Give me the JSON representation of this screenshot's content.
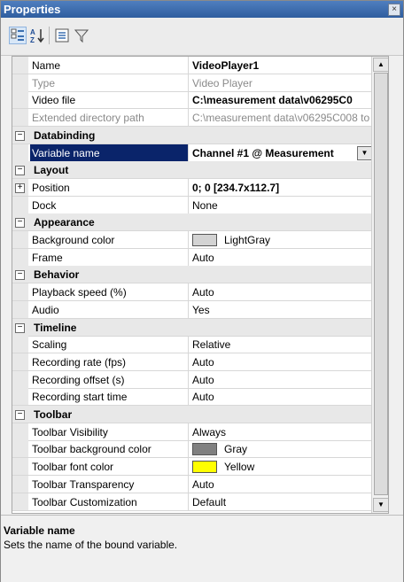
{
  "window": {
    "title": "Properties",
    "close_label": "×"
  },
  "toolbar": {
    "buttons": [
      {
        "name": "categorized-button",
        "icon": "categorized-icon"
      },
      {
        "name": "alphabetical-button",
        "icon": "sort-alphabetical-icon"
      },
      {
        "name": "property-pages-button",
        "icon": "property-pages-icon"
      },
      {
        "name": "filter-button",
        "icon": "filter-icon"
      }
    ]
  },
  "grid": {
    "rows": [
      {
        "kind": "prop",
        "label": "Name",
        "value": "VideoPlayer1",
        "bold": true
      },
      {
        "kind": "prop",
        "label": "Type",
        "value": "Video Player",
        "dim": true
      },
      {
        "kind": "prop",
        "label": "Video file",
        "value": "C:\\measurement data\\v06295C0",
        "bold": true
      },
      {
        "kind": "prop",
        "label": "Extended directory path",
        "value": "C:\\measurement data\\v06295C008 to",
        "dim": true
      },
      {
        "kind": "cat",
        "label": "Databinding",
        "expander": "−"
      },
      {
        "kind": "prop",
        "label": "Variable name",
        "value": "Channel #1 @ Measurement",
        "bold": true,
        "selected": true,
        "dropdown": true
      },
      {
        "kind": "cat",
        "label": "Layout",
        "expander": "−"
      },
      {
        "kind": "prop",
        "label": "Position",
        "value": "0; 0 [234.7x112.7]",
        "bold": true,
        "expander": "+"
      },
      {
        "kind": "prop",
        "label": "Dock",
        "value": "None"
      },
      {
        "kind": "cat",
        "label": "Appearance",
        "expander": "−"
      },
      {
        "kind": "prop",
        "label": "Background color",
        "value": "LightGray",
        "swatch": "#d3d3d3"
      },
      {
        "kind": "prop",
        "label": "Frame",
        "value": "Auto"
      },
      {
        "kind": "cat",
        "label": "Behavior",
        "expander": "−"
      },
      {
        "kind": "prop",
        "label": "Playback speed (%)",
        "value": "Auto"
      },
      {
        "kind": "prop",
        "label": "Audio",
        "value": "Yes"
      },
      {
        "kind": "cat",
        "label": "Timeline",
        "expander": "−"
      },
      {
        "kind": "prop",
        "label": "Scaling",
        "value": "Relative"
      },
      {
        "kind": "prop",
        "label": "Recording rate (fps)",
        "value": "Auto"
      },
      {
        "kind": "prop",
        "label": "Recording offset (s)",
        "value": "Auto"
      },
      {
        "kind": "prop",
        "label": "Recording start time",
        "value": "Auto"
      },
      {
        "kind": "cat",
        "label": "Toolbar",
        "expander": "−"
      },
      {
        "kind": "prop",
        "label": "Toolbar Visibility",
        "value": "Always"
      },
      {
        "kind": "prop",
        "label": "Toolbar background color",
        "value": "Gray",
        "swatch": "#808080"
      },
      {
        "kind": "prop",
        "label": "Toolbar font color",
        "value": "Yellow",
        "swatch": "#ffff00"
      },
      {
        "kind": "prop",
        "label": "Toolbar Transparency",
        "value": "Auto"
      },
      {
        "kind": "prop",
        "label": "Toolbar Customization",
        "value": "Default"
      }
    ]
  },
  "description": {
    "title": "Variable name",
    "text": "Sets the name of the bound variable."
  },
  "colors": {
    "selection": "#0a246a",
    "titlebar": "#2f5d9f"
  }
}
